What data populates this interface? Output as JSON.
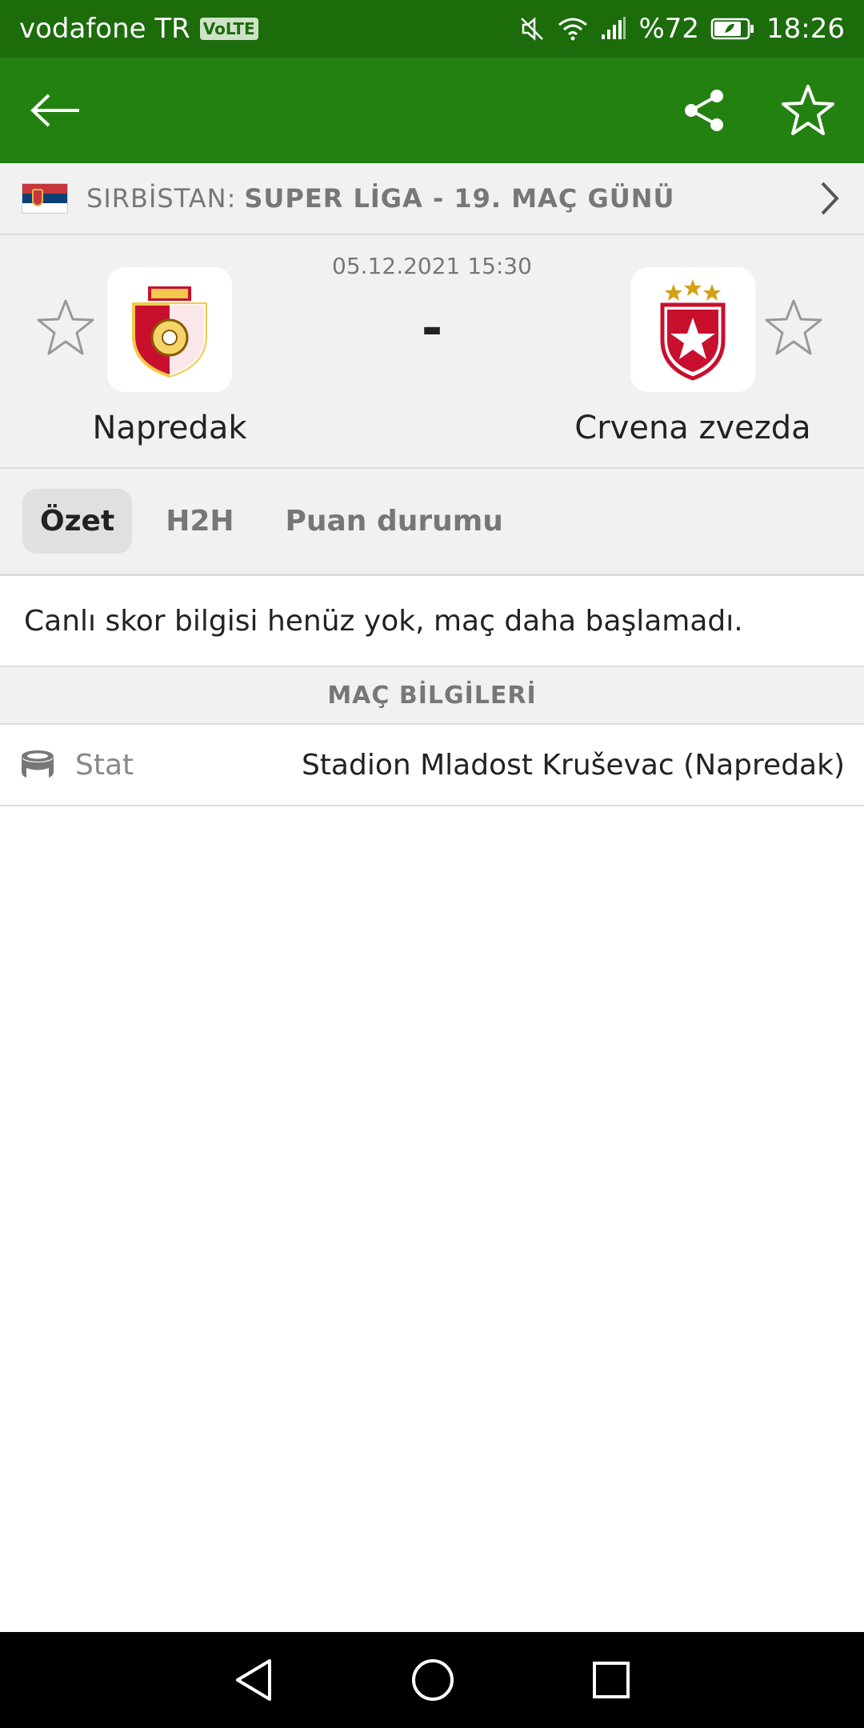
{
  "status_bar": {
    "carrier": "vodafone TR",
    "volte": "VoLTE",
    "battery": "%72",
    "time": "18:26"
  },
  "app_bar": {
    "back_icon": "arrow-left-icon",
    "share_icon": "share-icon",
    "favorite_icon": "star-outline-icon"
  },
  "league": {
    "country": "SIRBİSTAN:",
    "name": "SUPER LİGA - 19. MAÇ GÜNÜ"
  },
  "match": {
    "datetime": "05.12.2021 15:30",
    "score": "-",
    "home_team": {
      "name": "Napredak"
    },
    "away_team": {
      "name": "Crvena zvezda"
    }
  },
  "tabs": [
    {
      "label": "Özet",
      "active": true
    },
    {
      "label": "H2H",
      "active": false
    },
    {
      "label": "Puan durumu",
      "active": false
    }
  ],
  "notice": "Canlı skor bilgisi henüz yok, maç daha başlamadı.",
  "match_info": {
    "heading": "MAÇ BİLGİLERİ",
    "rows": [
      {
        "icon": "stadium-icon",
        "label": "Stat",
        "value": "Stadion Mladost Kruševac (Napredak)"
      }
    ]
  },
  "colors": {
    "status_bar": "#1c6c0c",
    "app_bar": "#238110",
    "panel": "#f1f1f1",
    "muted_text": "#777777"
  }
}
